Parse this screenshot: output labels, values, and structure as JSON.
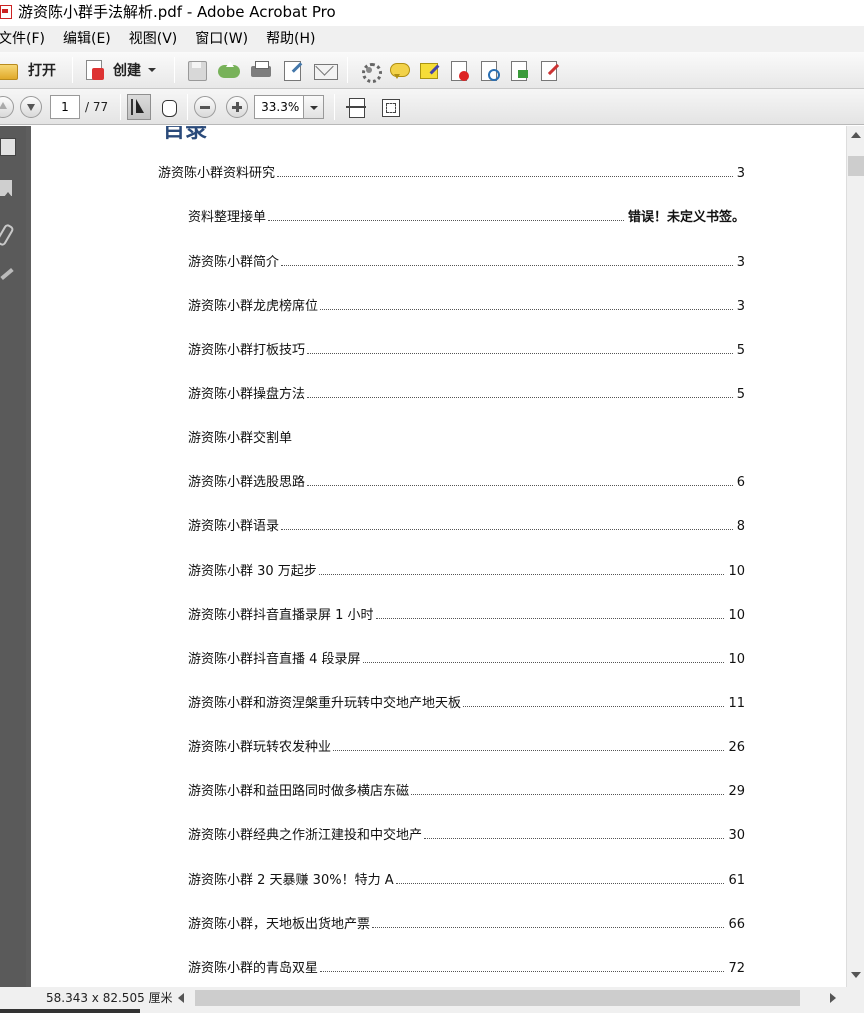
{
  "window": {
    "title": "游资陈小群手法解析.pdf - Adobe Acrobat Pro"
  },
  "menu": [
    "文件(F)",
    "编辑(E)",
    "视图(V)",
    "窗口(W)",
    "帮助(H)"
  ],
  "toolbar": {
    "open_label": "打开",
    "create_label": "创建"
  },
  "nav": {
    "page_current": "1",
    "page_total": "/ 77",
    "zoom": "33.3%"
  },
  "document": {
    "heading": "目录",
    "toc": [
      {
        "title": "游资陈小群资料研究",
        "page": "3",
        "level": 1
      },
      {
        "title": "资料整理接单",
        "page": "错误！未定义书签。",
        "level": 2,
        "bold": true
      },
      {
        "title": "游资陈小群简介",
        "page": "3",
        "level": 2
      },
      {
        "title": "游资陈小群龙虎榜席位",
        "page": "3",
        "level": 2
      },
      {
        "title": "游资陈小群打板技巧",
        "page": "5",
        "level": 2
      },
      {
        "title": "游资陈小群操盘方法",
        "page": "5",
        "level": 2
      },
      {
        "title": "游资陈小群交割单",
        "page": "",
        "level": 2
      },
      {
        "title": "游资陈小群选股思路",
        "page": "6",
        "level": 2
      },
      {
        "title": "游资陈小群语录",
        "page": "8",
        "level": 2
      },
      {
        "title": "游资陈小群 30 万起步",
        "page": "10",
        "level": 2
      },
      {
        "title": "游资陈小群抖音直播录屏 1 小时",
        "page": "10",
        "level": 2
      },
      {
        "title": "游资陈小群抖音直播 4 段录屏",
        "page": "10",
        "level": 2
      },
      {
        "title": "游资陈小群和游资涅槃重升玩转中交地产地天板",
        "page": "11",
        "level": 2
      },
      {
        "title": "游资陈小群玩转农发种业",
        "page": "26",
        "level": 2
      },
      {
        "title": "游资陈小群和益田路同时做多横店东磁",
        "page": "29",
        "level": 2
      },
      {
        "title": "游资陈小群经典之作浙江建投和中交地产",
        "page": "30",
        "level": 2
      },
      {
        "title": "游资陈小群 2 天暴赚 30%！特力 A",
        "page": "61",
        "level": 2
      },
      {
        "title": "游资陈小群，天地板出货地产票",
        "page": "66",
        "level": 2
      },
      {
        "title": "游资陈小群的青岛双星",
        "page": "72",
        "level": 2
      }
    ]
  },
  "status": {
    "page_size": "58.343 x 82.505 厘米"
  }
}
